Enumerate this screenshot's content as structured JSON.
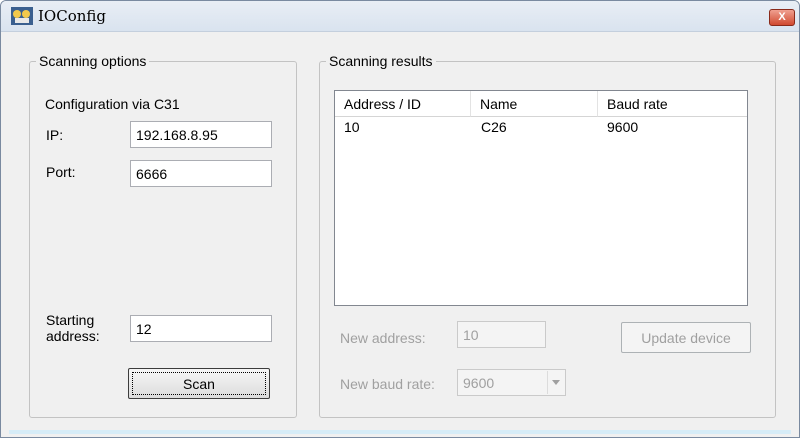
{
  "window": {
    "title": "IOConfig",
    "close_label": "X",
    "accent_color": "#d04a30"
  },
  "scan_options": {
    "legend": "Scanning options",
    "config_label": "Configuration via C31",
    "ip_label": "IP:",
    "ip_value": "192.168.8.95",
    "port_label": "Port:",
    "port_value": "6666",
    "starting_label_line1": "Starting",
    "starting_label_line2": "address:",
    "starting_value": "12",
    "scan_button": "Scan"
  },
  "scan_results": {
    "legend": "Scanning results",
    "columns": [
      "Address / ID",
      "Name",
      "Baud rate"
    ],
    "rows": [
      [
        "10",
        "C26",
        "9600"
      ]
    ],
    "new_address_label": "New address:",
    "new_address_value": "10",
    "new_baud_label": "New baud rate:",
    "new_baud_value": "9600",
    "update_button": "Update device"
  }
}
